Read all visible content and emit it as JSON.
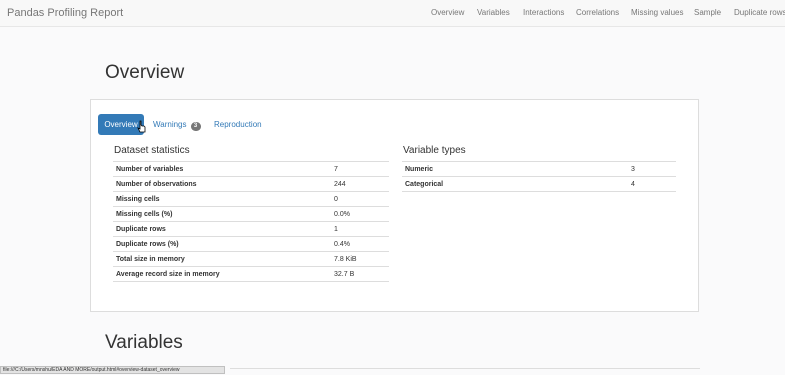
{
  "navbar": {
    "brand": "Pandas Profiling Report",
    "links": [
      "Overview",
      "Variables",
      "Interactions",
      "Correlations",
      "Missing values",
      "Sample",
      "Duplicate rows"
    ]
  },
  "overview": {
    "heading": "Overview",
    "tabs": {
      "overview": "Overview",
      "warnings": "Warnings",
      "warnings_count": "3",
      "reproduction": "Reproduction"
    },
    "dataset_statistics": {
      "title": "Dataset statistics",
      "rows": [
        {
          "label": "Number of variables",
          "value": "7"
        },
        {
          "label": "Number of observations",
          "value": "244"
        },
        {
          "label": "Missing cells",
          "value": "0"
        },
        {
          "label": "Missing cells (%)",
          "value": "0.0%"
        },
        {
          "label": "Duplicate rows",
          "value": "1"
        },
        {
          "label": "Duplicate rows (%)",
          "value": "0.4%"
        },
        {
          "label": "Total size in memory",
          "value": "7.8 KiB"
        },
        {
          "label": "Average record size in memory",
          "value": "32.7 B"
        }
      ]
    },
    "variable_types": {
      "title": "Variable types",
      "rows": [
        {
          "label": "Numeric",
          "value": "3"
        },
        {
          "label": "Categorical",
          "value": "4"
        }
      ]
    }
  },
  "variables": {
    "heading": "Variables"
  },
  "status_bar": {
    "url": "file:///C:/Users/mnshu/EDA AND MORE/output.html#overview-dataset_overview"
  },
  "colors": {
    "accent": "#337ab7",
    "badge": "#777777"
  }
}
